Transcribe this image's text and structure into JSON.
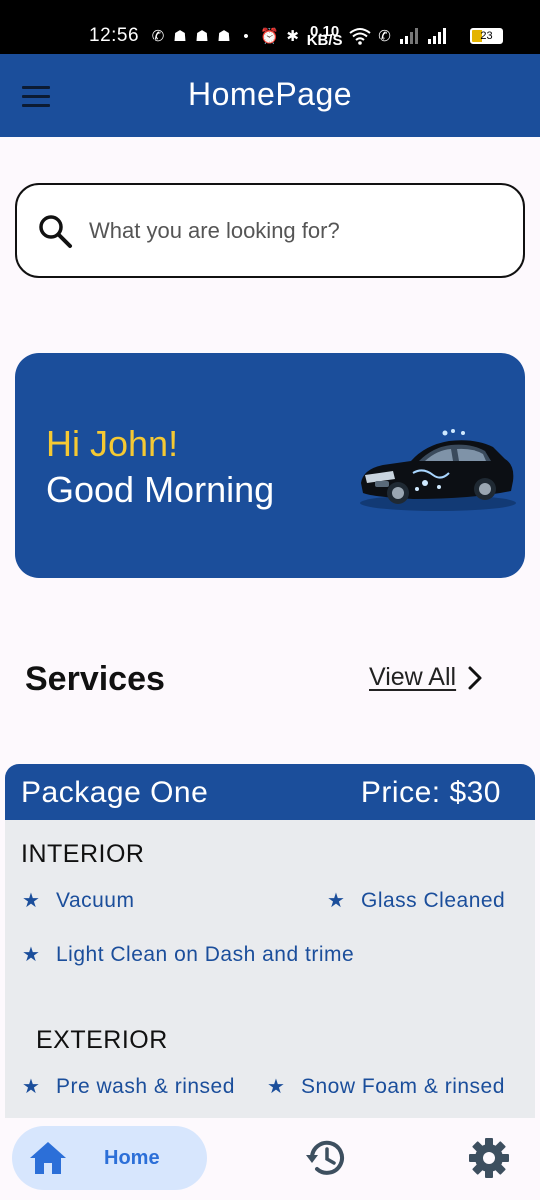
{
  "status_bar": {
    "time": "12:56",
    "network_speed_value": "0.10",
    "network_speed_unit": "KB/S",
    "battery": "23"
  },
  "app_bar": {
    "title": "HomePage"
  },
  "search": {
    "placeholder": "What you are looking for?"
  },
  "greeting": {
    "line1": "Hi John!",
    "line2": "Good Morning"
  },
  "services": {
    "title": "Services",
    "view_all": "View All"
  },
  "package": {
    "name": "Package One",
    "price": "Price: $30",
    "interior": {
      "title": "INTERIOR",
      "items": [
        "Vacuum",
        "Glass Cleaned",
        "Light Clean on Dash and trime"
      ]
    },
    "exterior": {
      "title": "EXTERIOR",
      "items": [
        "Pre wash & rinsed",
        "Snow Foam & rinsed"
      ]
    }
  },
  "bottom_nav": {
    "home_label": "Home"
  },
  "colors": {
    "primary": "#1b4e9b",
    "accent_yellow": "#f5c933",
    "nav_active_bg": "#d7e6fd",
    "nav_active_text": "#2c6fd8",
    "card_bg": "#e9ebee"
  },
  "icons": [
    "menu-icon",
    "search-icon",
    "car-image",
    "chevron-right-icon",
    "star-icon",
    "home-icon",
    "history-icon",
    "gear-icon"
  ]
}
